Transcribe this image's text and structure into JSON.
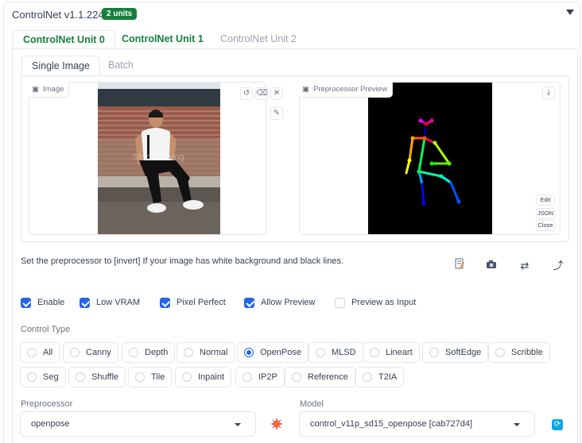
{
  "header": {
    "title": "ControlNet v1.1.224",
    "badge": "2 units"
  },
  "unit_tabs": [
    "ControlNet Unit 0",
    "ControlNet Unit 1",
    "ControlNet Unit 2"
  ],
  "image_tabs": [
    "Single Image",
    "Batch"
  ],
  "image_box": {
    "label": "Image",
    "overlay_text": "Start drawing"
  },
  "preview_box": {
    "label": "Preprocessor Preview",
    "buttons": [
      "Edit",
      "JSON",
      "Close"
    ]
  },
  "hint": "Set the preprocessor to [invert] If your image has white background and black lines.",
  "checkboxes": [
    {
      "label": "Enable",
      "checked": true
    },
    {
      "label": "Low VRAM",
      "checked": true
    },
    {
      "label": "Pixel Perfect",
      "checked": true
    },
    {
      "label": "Allow Preview",
      "checked": true
    },
    {
      "label": "Preview as Input",
      "checked": false
    }
  ],
  "control_type": {
    "label": "Control Type",
    "options": [
      "All",
      "Canny",
      "Depth",
      "Normal",
      "OpenPose",
      "MLSD",
      "Lineart",
      "SoftEdge",
      "Scribble",
      "Seg",
      "Shuffle",
      "Tile",
      "Inpaint",
      "IP2P",
      "Reference",
      "T2IA"
    ],
    "selected": "OpenPose"
  },
  "preprocessor": {
    "label": "Preprocessor",
    "value": "openpose"
  },
  "model": {
    "label": "Model",
    "value": "control_v11p_sd15_openpose [cab727d4]"
  },
  "colors": {
    "accent_green": "#15803d",
    "checkbox_blue": "#2563eb"
  }
}
